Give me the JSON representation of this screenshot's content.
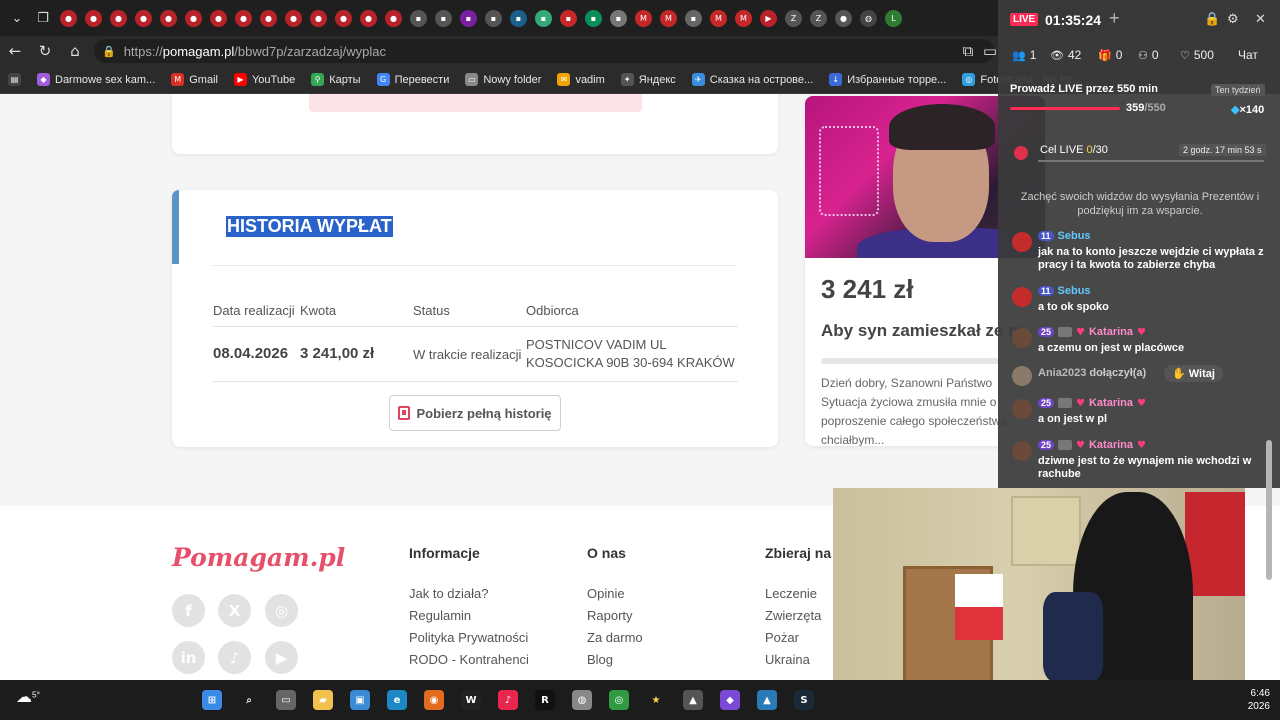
{
  "browser": {
    "url": {
      "protocol": "https://",
      "host": "pomagam.pl",
      "path": "/bbwd7p/zarzadzaj/wyplac"
    },
    "bookmarks": [
      {
        "label": "Darmowe sex kam...",
        "icon": "video-chat-icon",
        "color": "#a25bdc"
      },
      {
        "label": "Gmail",
        "icon": "gmail-icon",
        "color": "#d93025"
      },
      {
        "label": "YouTube",
        "icon": "youtube-icon",
        "color": "#ff0000"
      },
      {
        "label": "Карты",
        "icon": "maps-icon",
        "color": "#34a853"
      },
      {
        "label": "Перевести",
        "icon": "translate-icon",
        "color": "#4285f4"
      },
      {
        "label": "Nowy folder",
        "icon": "folder-icon",
        "color": "#888888"
      },
      {
        "label": "vadim",
        "icon": "mail-icon",
        "color": "#f4a300"
      },
      {
        "label": "Яндекс",
        "icon": "sparkle-icon",
        "color": "#555555"
      },
      {
        "label": "Сказка на острове...",
        "icon": "bird-icon",
        "color": "#3a8ddc"
      },
      {
        "label": "Избранные торре...",
        "icon": "torrent-icon",
        "color": "#3b6bd8"
      },
      {
        "label": "Fotostrana - No Int...",
        "icon": "fotostrana-icon",
        "color": "#2ea0e0"
      }
    ]
  },
  "page": {
    "history_title": "HISTORIA WYPŁAT",
    "columns": [
      "Data realizacji",
      "Kwota",
      "Status",
      "Odbiorca"
    ],
    "row": {
      "date": "08.04.2026",
      "amount": "3 241,00 zł",
      "status": "W trakcie realizacji",
      "recipient": "POSTNICOV VADIM UL KOSOCICKA 90B 30-694 KRAKÓW"
    },
    "download_button": "Pobierz pełną historię",
    "campaign": {
      "amount": "3 241 zł",
      "title": "Aby syn zamieszkał ze m",
      "description": "Dzień dobry, Szanowni Państwo Sytuacja życiowa zmusiła mnie o poproszenie całego społeczeństwa chciałbym..."
    },
    "footer": {
      "logo": "Pomagam.pl",
      "columns": [
        {
          "title": "Informacje",
          "links": [
            "Jak to działa?",
            "Regulamin",
            "Polityka Prywatności",
            "RODO - Kontrahenci"
          ]
        },
        {
          "title": "O nas",
          "links": [
            "Opinie",
            "Raporty",
            "Za darmo",
            "Blog"
          ]
        },
        {
          "title": "Zbieraj na",
          "links": [
            "Leczenie",
            "Zwierzęta",
            "Pożar",
            "Ukraina"
          ]
        }
      ],
      "social": [
        "facebook-icon",
        "x-icon",
        "instagram-icon",
        "linkedin-icon",
        "tiktok-icon",
        "youtube-icon"
      ]
    }
  },
  "live": {
    "badge": "LIVE",
    "time": "01:35:24",
    "stats": {
      "users": "1",
      "viewers": "42",
      "gifts": "0",
      "guests": "0",
      "likes": "500"
    },
    "chat_label": "Чат",
    "goal_title": "Prowadź LIVE przez 550 min",
    "week_label": "Ten tydzień",
    "progress_now": "359",
    "progress_max": "/550",
    "gems": "×140",
    "goal_label": "Cel LIVE ",
    "goal_now": "0",
    "goal_max": "/30",
    "goal_time": "2 godz. 17 min 53 s",
    "encourage": "Zachęć swoich widzów do wysyłania Prezentów i podziękuj im za wsparcie.",
    "messages": [
      {
        "user": "Sebus",
        "level": "11",
        "text": "jak na to konto jeszcze wejdzie ci wypłata z pracy i ta kwota to zabierze chyba"
      },
      {
        "user": "Sebus",
        "level": "11",
        "text": "a to ok spoko"
      },
      {
        "user": "Katarina",
        "level": "25",
        "text": "a czemu on jest w placówce"
      },
      {
        "user": "Katarina",
        "level": "25",
        "text": "a on jest w pl"
      },
      {
        "user": "Katarina",
        "level": "25",
        "text": "dziwne jest to że wynajem nie wchodzi w rachube"
      }
    ],
    "joined_user": "Ania2023",
    "joined_text": " dołączył(a)",
    "wave_button": "Witaj"
  },
  "taskbar": {
    "weather": "5°",
    "time": "6:46",
    "date": "2026"
  }
}
